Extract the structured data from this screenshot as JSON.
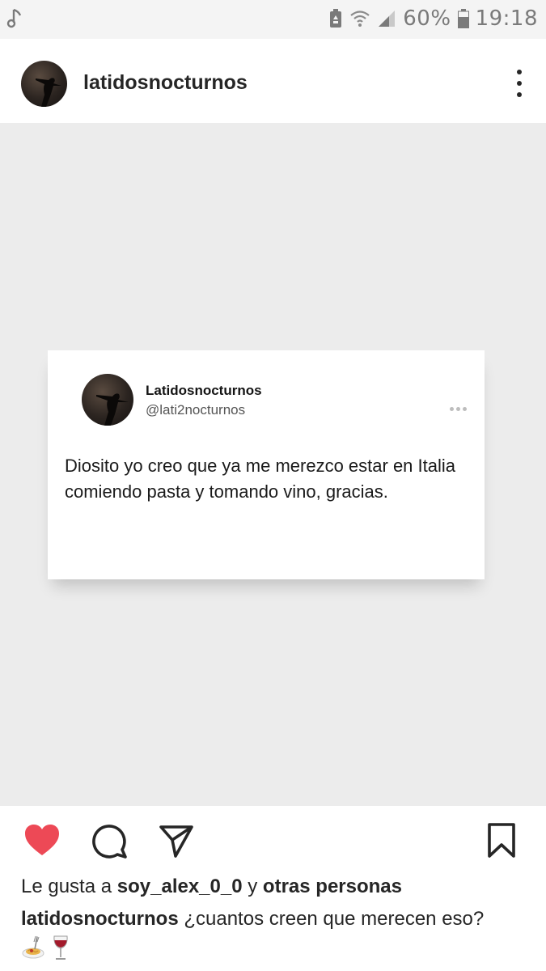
{
  "status_bar": {
    "battery_percent": "60%",
    "time": "19:18"
  },
  "header": {
    "username": "latidosnocturnos"
  },
  "tweet": {
    "display_name": "Latidosnocturnos",
    "handle": "@lati2nocturnos",
    "text": "Diosito yo creo que ya me merezco estar en Italia comiendo pasta y tomando vino, gracias."
  },
  "actions": {
    "liked": true,
    "like_color": "#ed4956"
  },
  "likes": {
    "prefix": "Le gusta a",
    "user": "soy_alex_0_0",
    "connector": "y",
    "others": "otras personas"
  },
  "caption": {
    "username": "latidosnocturnos",
    "text": "¿cuantos creen que merecen eso?",
    "emojis": [
      "spaghetti-icon",
      "wine-glass-icon"
    ]
  }
}
